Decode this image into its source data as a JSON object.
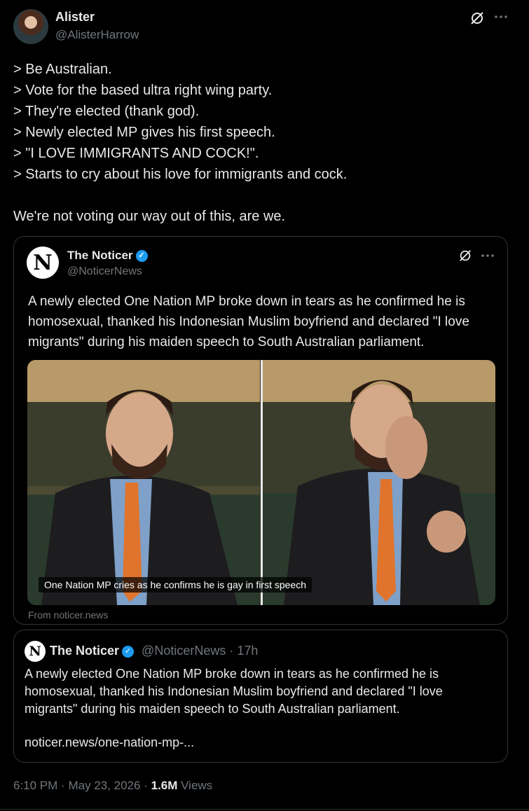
{
  "author": {
    "name": "Alister",
    "handle": "@AlisterHarrow"
  },
  "tweet_text": "> Be Australian.\n> Vote for the based ultra right wing party.\n> They're elected (thank god).\n> Newly elected MP gives his first speech.\n> \"I LOVE IMMIGRANTS AND COCK!\".\n> Starts to cry about his love for immigrants and cock.\n\nWe're not voting our way out of this, are we.",
  "icons": {
    "grok": "grok-slash-icon",
    "more": "more-dots-icon",
    "verified": "verified-badge-icon"
  },
  "embedded": {
    "logo_letter": "N",
    "name": "The Noticer",
    "handle": "@NoticerNews",
    "text": "A newly elected One Nation MP broke down in tears as he confirmed he is homosexual, thanked his Indonesian Muslim boyfriend and declared \"I love migrants\" during his maiden speech to South Australian parliament.",
    "media_caption": "One Nation MP cries as he confirms he is gay in first speech",
    "source": "From noticer.news"
  },
  "quote": {
    "logo_letter": "N",
    "name": "The Noticer",
    "handle": "@NoticerNews",
    "separator": "·",
    "time": "17h",
    "text": "A newly elected One Nation MP broke down in tears as he confirmed he is homosexual, thanked his Indonesian Muslim boyfriend and declared \"I love migrants\" during his maiden speech to South Australian parliament.",
    "link": "noticer.news/one-nation-mp-..."
  },
  "footer": {
    "time": "6:10 PM",
    "sep1": "·",
    "date": "May 23, 2026",
    "sep2": "·",
    "views_count": "1.6M",
    "views_label": "Views"
  },
  "colors": {
    "background": "#000000",
    "text": "#e7e9ea",
    "muted": "#71767b",
    "border": "#2f3336",
    "verified": "#1d9bf0"
  }
}
